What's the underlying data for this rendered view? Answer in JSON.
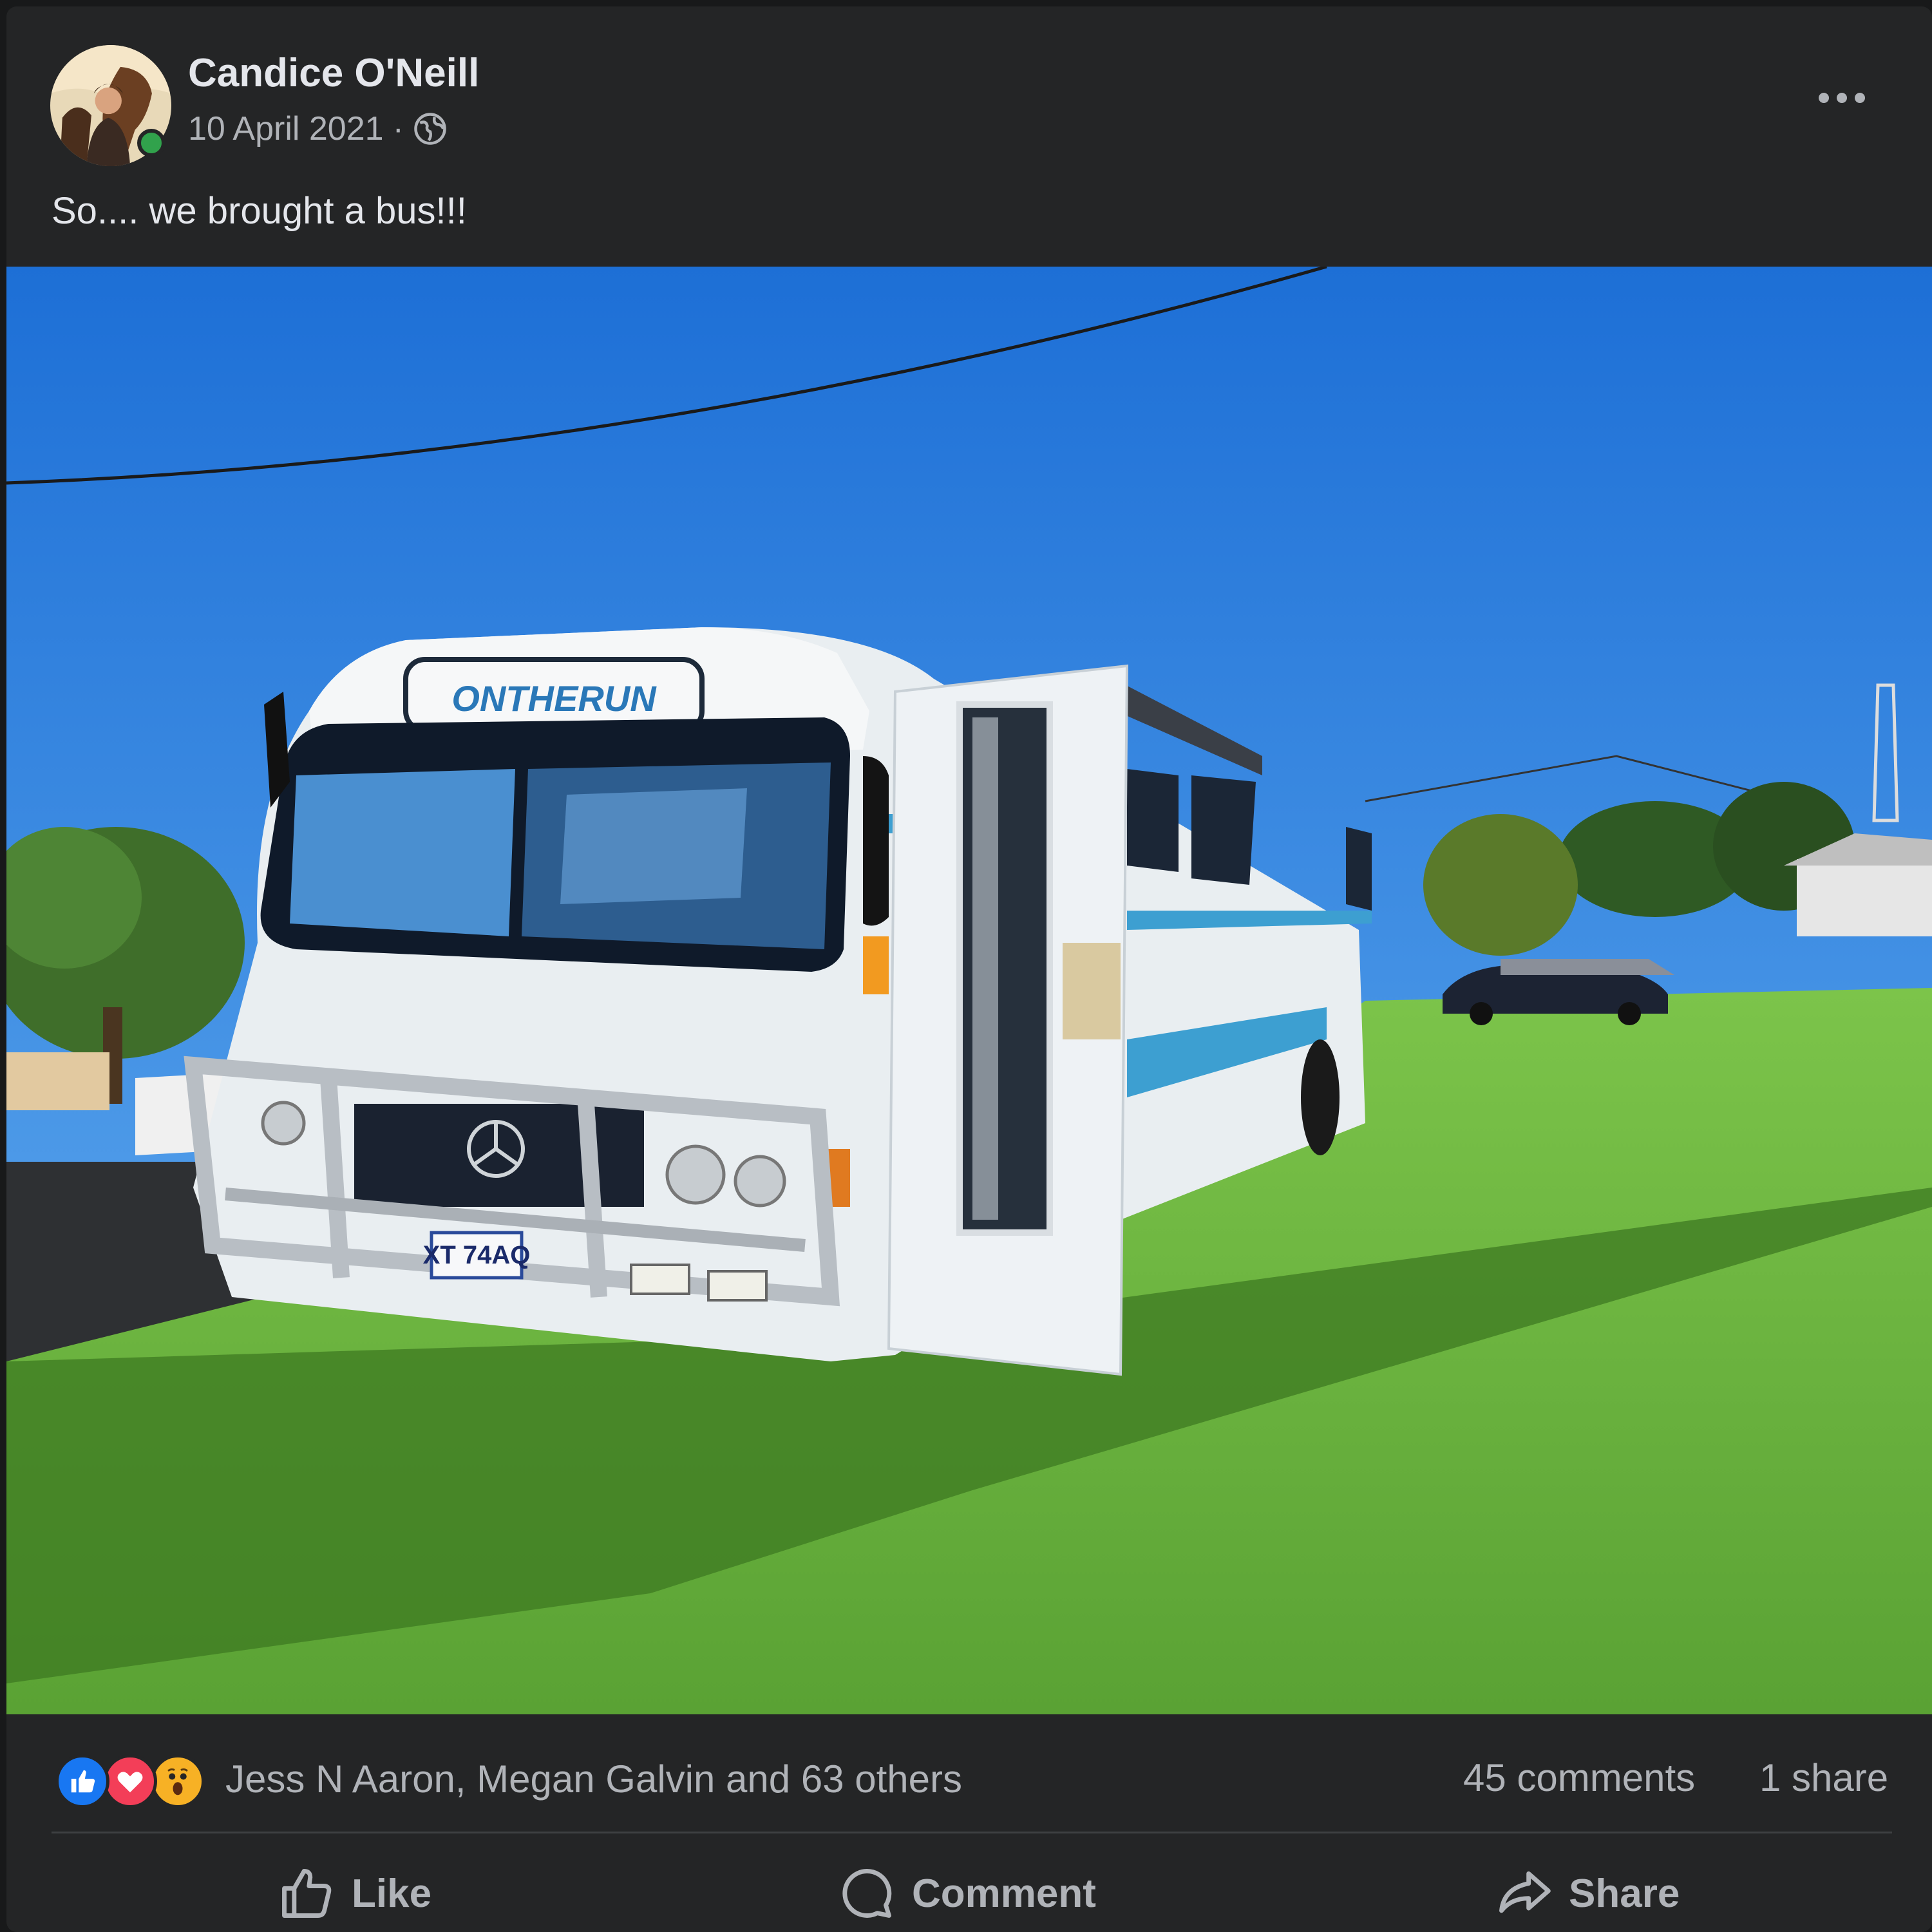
{
  "post": {
    "author": "Candice O'Neill",
    "date": "10 April 2021",
    "separator": "·",
    "privacy_icon": "globe-icon",
    "text": "So.... we brought a bus!!!",
    "photo": {
      "bus_sign": "ONTHERUN",
      "number_plate": "XT 74AQ"
    }
  },
  "engagement": {
    "reaction_icons": [
      "like-reaction-icon",
      "love-reaction-icon",
      "wow-reaction-icon"
    ],
    "reacted_by": "Jess N Aaron, Megan Galvin and 63 others",
    "comments": "45 comments",
    "shares": "1 share"
  },
  "actions": {
    "like": "Like",
    "comment": "Comment",
    "share": "Share"
  },
  "colors": {
    "background": "#18191a",
    "card": "#242526",
    "primary_text": "#e4e6eb",
    "secondary_text": "#b0b3b8",
    "like_blue": "#1877f2",
    "love_red": "#f33e58",
    "wow_yellow": "#f7b125",
    "online_green": "#31a24c"
  }
}
